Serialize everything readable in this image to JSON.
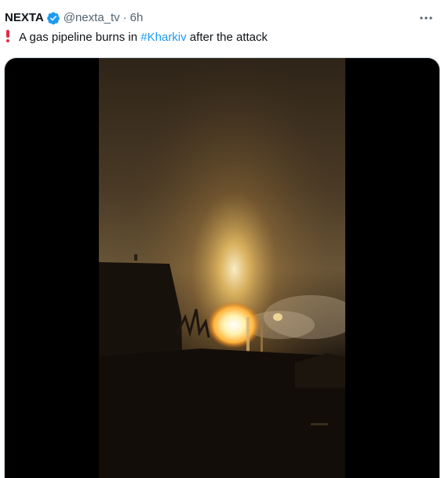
{
  "tweet": {
    "display_name": "NEXTA",
    "handle": "@nexta_tv",
    "separator": "·",
    "timestamp": "6h",
    "text_before": "A gas pipeline burns in ",
    "hashtag": "#Kharkiv",
    "text_after": " after the attack"
  },
  "icons": {
    "verified": "verified-badge-icon",
    "more": "more-options-icon",
    "exclamation": "red-exclamation-icon"
  },
  "colors": {
    "text": "#0f1419",
    "secondary": "#536471",
    "link": "#1d9bf0",
    "verified": "#1d9bf0",
    "exclamation": "#dd2e44"
  }
}
